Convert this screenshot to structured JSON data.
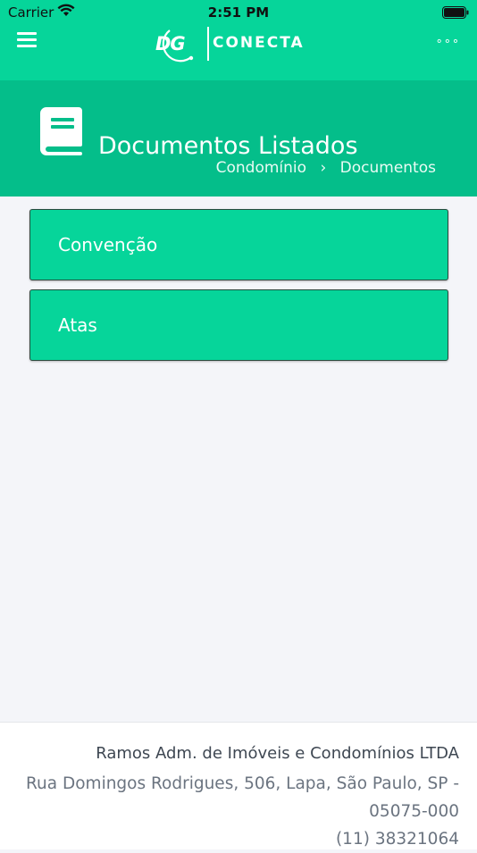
{
  "status_bar": {
    "carrier": "Carrier",
    "time": "2:51 PM"
  },
  "header": {
    "logo_mark": "DG",
    "logo_text": "CONECTA",
    "menu_icon": "hamburger-icon",
    "more_icon": "more-horizontal-icon",
    "more_label": "∘∘∘"
  },
  "page": {
    "title": "Documentos Listados",
    "title_icon": "book-icon",
    "breadcrumb": [
      "Condomínio",
      "Documentos"
    ],
    "breadcrumb_separator": "›"
  },
  "documents": [
    {
      "label": "Convenção"
    },
    {
      "label": "Atas"
    }
  ],
  "footer": {
    "company": "Ramos Adm. de Imóveis e Condomínios LTDA",
    "address": "Rua Domingos Rodrigues, 506, Lapa, São Paulo, SP - 05075-000",
    "phone": "(11) 38321064"
  },
  "colors": {
    "primary": "#06d59a",
    "primary_dark": "#04be8a",
    "background": "#f4f5f9"
  }
}
